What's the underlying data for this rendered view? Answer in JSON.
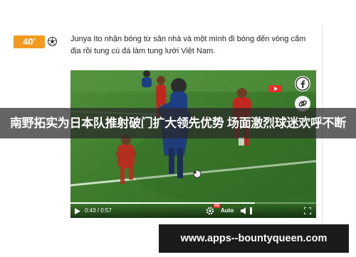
{
  "event": {
    "minute": "40'",
    "icon": "soccer-ball-icon",
    "commentary": "Junya Ito nhận bóng từ sân nhà và một mình đi bóng đến vòng cấm địa rồi tung cú đá làm tung lưới Việt Nam."
  },
  "video": {
    "time_current": "0:43",
    "time_separator": " / ",
    "time_total": "0:57",
    "progress_fraction": 0.75,
    "hd_label": "HD",
    "quality": "Auto",
    "share_icons": [
      "facebook-icon",
      "link-icon"
    ],
    "controls_icons": [
      "play-icon",
      "volume-icon",
      "settings-icon",
      "fullscreen-icon"
    ]
  },
  "overlay": {
    "headline": "南野拓实为日本队推射破门扩大领先优势 场面激烈球迷欢呼不断"
  },
  "watermark": {
    "url": "www.apps--bountyqueen.com"
  },
  "colors": {
    "badge": "#f39a1e",
    "pitch": "#3f7f2f",
    "hd_badge": "#e8302b",
    "banner_dark": "#1b1b1b"
  }
}
